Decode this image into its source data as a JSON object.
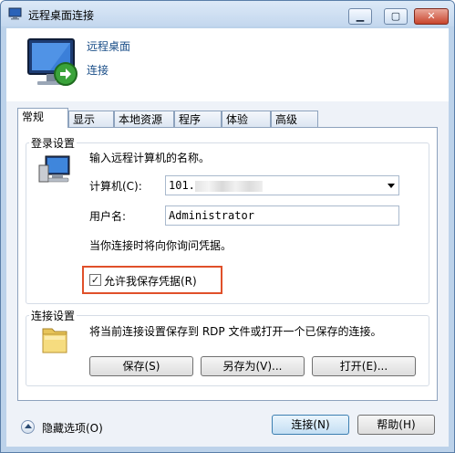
{
  "window": {
    "title": "远程桌面连接",
    "controls": {
      "minimize": "▭",
      "maximize": "▢",
      "close": "✕"
    }
  },
  "header": {
    "line1": "远程桌面",
    "line2": "连接"
  },
  "tabs": [
    {
      "label": "常规",
      "active": true
    },
    {
      "label": "显示",
      "active": false
    },
    {
      "label": "本地资源",
      "active": false
    },
    {
      "label": "程序",
      "active": false
    },
    {
      "label": "体验",
      "active": false
    },
    {
      "label": "高级",
      "active": false
    }
  ],
  "login": {
    "legend": "登录设置",
    "instruction": "输入远程计算机的名称。",
    "computer_label": "计算机(C):",
    "computer_value": "101.",
    "username_label": "用户名:",
    "username_value": "Administrator",
    "prompt_text": "当你连接时将向你询问凭据。",
    "save_credentials_label": "允许我保存凭据(R)",
    "save_credentials_checked": true
  },
  "connection": {
    "legend": "连接设置",
    "description": "将当前连接设置保存到 RDP 文件或打开一个已保存的连接。",
    "save_button": "保存(S)",
    "save_as_button": "另存为(V)...",
    "open_button": "打开(E)..."
  },
  "footer": {
    "hide_options": "隐藏选项(O)",
    "connect_button": "连接(N)",
    "help_button": "帮助(H)"
  },
  "colors": {
    "header_text": "#1a4e88",
    "highlight_border": "#e0502a"
  }
}
